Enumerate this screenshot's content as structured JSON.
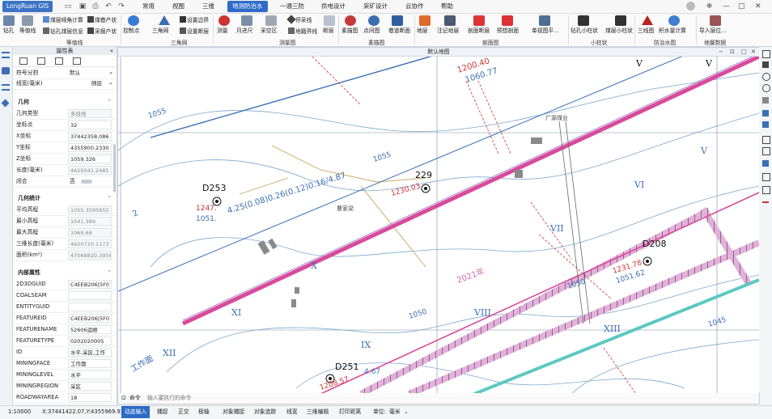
{
  "app": {
    "name": "LongRuan GIS"
  },
  "menu": [
    "常用",
    "视图",
    "三维",
    "地测防治水",
    "一通三防",
    "供电设计",
    "采矿设计",
    "云协作",
    "帮助"
  ],
  "menu_active": "地测防治水",
  "ribbon": {
    "rows": [
      {
        "label": "钻孔"
      },
      {
        "label": "等值线"
      },
      {
        "label": "煤层倾角计算"
      },
      {
        "label": "煤巷产状"
      },
      {
        "label": "钻孔煤层信息"
      },
      {
        "label": "采掘产状"
      },
      {
        "label": "控制点"
      },
      {
        "label": "三角网"
      },
      {
        "label": "设置边界"
      },
      {
        "label": "设置断层"
      },
      {
        "label": "测量"
      },
      {
        "label": "月进尺"
      },
      {
        "label": "采空区"
      },
      {
        "label": "停采线"
      },
      {
        "label": "地籍界线"
      },
      {
        "label": "断层"
      },
      {
        "label": "素描图"
      },
      {
        "label": "点间图"
      },
      {
        "label": "巷道断面"
      },
      {
        "label": "地层"
      },
      {
        "label": "注记地层"
      },
      {
        "label": "剖面断层"
      },
      {
        "label": "预想剖面"
      },
      {
        "label": "单视图平..."
      },
      {
        "label": "钻孔小柱状"
      },
      {
        "label": "煤层小柱状"
      },
      {
        "label": "三线图"
      },
      {
        "label": "积水量计算"
      },
      {
        "label": "导入层位..."
      }
    ],
    "groups": [
      "等值线",
      "三角网",
      "测量图",
      "素描图",
      "剖面图",
      "小柱状",
      "防治水图",
      "地層数据"
    ]
  },
  "left_panel": {
    "title": "属性表",
    "rows_top": [
      {
        "k": "符号分割",
        "v": "默认"
      },
      {
        "k": "线宽(毫米)",
        "v": "随层"
      }
    ],
    "sections": [
      {
        "title": "几何",
        "rows": [
          {
            "k": "几何类型",
            "v": "多段线"
          },
          {
            "k": "坐标点",
            "v": "32"
          },
          {
            "k": "X坐标",
            "v": "37442358.086"
          },
          {
            "k": "Y坐标",
            "v": "4355900.2330"
          },
          {
            "k": "Z坐标",
            "v": "1059.326"
          },
          {
            "k": "长度(毫米)",
            "v": "4620041.2485"
          },
          {
            "k": "闭合",
            "v": "否"
          }
        ]
      },
      {
        "title": "几何统计",
        "rows": [
          {
            "k": "平均高程",
            "v": "1055.3595855"
          },
          {
            "k": "最小高程",
            "v": "1041.389"
          },
          {
            "k": "最大高程",
            "v": "1069.68"
          },
          {
            "k": "三维长度(毫米)",
            "v": "4620720.1173"
          },
          {
            "k": "面积(km²)",
            "v": "47068820.3956"
          }
        ]
      },
      {
        "title": "内部属性",
        "rows": [
          {
            "k": "2D3DGUID",
            "v": "C4EEB206|5F0"
          },
          {
            "k": "COALSEAM",
            "v": ""
          },
          {
            "k": "ENTITYGUID",
            "v": ""
          },
          {
            "k": "FEATUREID",
            "v": "C4EEB206|5F0"
          },
          {
            "k": "FEATURENAME",
            "v": "52606运顺"
          },
          {
            "k": "FEATURETYPE",
            "v": "0202020005"
          },
          {
            "k": "ID",
            "v": "水平,采区,工作"
          },
          {
            "k": "MININGFACE",
            "v": "工作面"
          },
          {
            "k": "MININGLEVEL",
            "v": "水平"
          },
          {
            "k": "MININGREGION",
            "v": "采区"
          },
          {
            "k": "ROADWAYAREA",
            "v": "18"
          }
        ]
      }
    ]
  },
  "map": {
    "title": "默认地图",
    "labels": {
      "d253": "D253",
      "d251": "D251",
      "d208": "D208",
      "p229": "229",
      "e1247": "1247.",
      "e1051": "1051.",
      "e1230": "1230.03",
      "e1200": "1200.40",
      "e1060": "1060.77",
      "e1231": "1231.78",
      "e1051b": "1051.62",
      "e1208": "1208.57",
      "e4_6": "4.67",
      "d_long": "4.25(0.08)0.26(0.12)0.16/4.87",
      "c1055a": "1055",
      "c1055b": "1055",
      "c1050a": "1050",
      "c1050b": "1050",
      "c1045": "1045",
      "year2021": "2021年",
      "mine": "广源煤业",
      "village": "曹家梁",
      "r_vi": "VI",
      "r_v": "V",
      "r_v2": "V",
      "r_vii": "VII",
      "r_viii": "VIII",
      "r_ix": "IX",
      "r_x": "X",
      "r_xi": "XI",
      "r_xii": "XII",
      "r_xiii": "XIII",
      "two": "2",
      "work": "工作面"
    }
  },
  "command": {
    "prompt": "命令",
    "placeholder": "输入要执行的命令"
  },
  "status": {
    "scale": "1:10000",
    "coords": "X:37441422.07,Y:4355969.93",
    "items": [
      "动态输入",
      "捕捉",
      "正交",
      "极轴",
      "对象捕捉",
      "对象追踪",
      "线宽",
      "三维编辑",
      "打印距离"
    ],
    "unit_label": "单位:",
    "unit_value": "毫米"
  },
  "colors": {
    "accent": "#2d6bc7",
    "road_magenta": "#d94a9b",
    "road_purple": "#8e6cc6",
    "contour": "#7aa8cf"
  }
}
